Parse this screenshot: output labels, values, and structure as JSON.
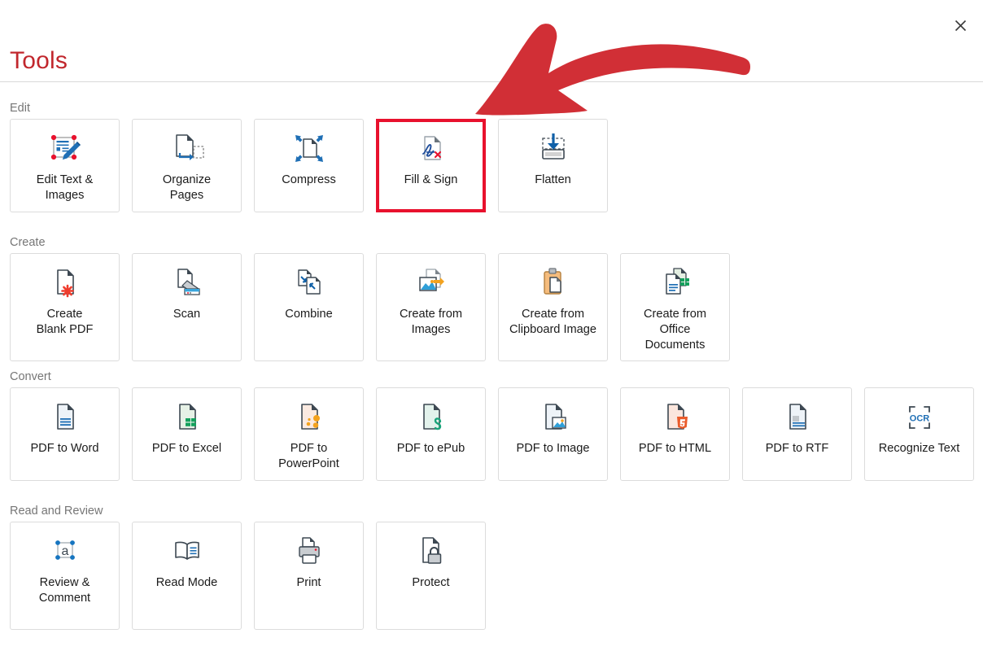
{
  "window": {
    "title": "Tools",
    "close_label": "×",
    "close_icon": "close-icon",
    "title_color": "#c1272d"
  },
  "annotation": {
    "type": "hand-drawn-arrow",
    "color": "#d12f36",
    "points_to": "Fill & Sign"
  },
  "highlight": {
    "target": "Fill & Sign",
    "color": "#e8112d"
  },
  "sections": [
    {
      "label": "Edit",
      "cards": [
        {
          "label": "Edit Text &\nImages",
          "icon": "edit-text-images-icon"
        },
        {
          "label": "Organize\nPages",
          "icon": "organize-pages-icon"
        },
        {
          "label": "Compress",
          "icon": "compress-icon"
        },
        {
          "label": "Fill & Sign",
          "icon": "fill-and-sign-icon",
          "highlighted": true
        },
        {
          "label": "Flatten",
          "icon": "flatten-icon"
        }
      ]
    },
    {
      "label": "Create",
      "cards": [
        {
          "label": "Create\nBlank PDF",
          "icon": "create-blank-pdf-icon"
        },
        {
          "label": "Scan",
          "icon": "scan-icon"
        },
        {
          "label": "Combine",
          "icon": "combine-icon"
        },
        {
          "label": "Create from\nImages",
          "icon": "create-from-images-icon"
        },
        {
          "label": "Create from\nClipboard Image",
          "icon": "create-from-clipboard-image-icon"
        },
        {
          "label": "Create from\nOffice\nDocuments",
          "icon": "create-from-office-documents-icon"
        }
      ]
    },
    {
      "label": "Convert",
      "cards": [
        {
          "label": "PDF to Word",
          "icon": "pdf-to-word-icon"
        },
        {
          "label": "PDF to Excel",
          "icon": "pdf-to-excel-icon"
        },
        {
          "label": "PDF to\nPowerPoint",
          "icon": "pdf-to-powerpoint-icon"
        },
        {
          "label": "PDF to ePub",
          "icon": "pdf-to-epub-icon"
        },
        {
          "label": "PDF to Image",
          "icon": "pdf-to-image-icon"
        },
        {
          "label": "PDF to HTML",
          "icon": "pdf-to-html-icon"
        },
        {
          "label": "PDF to RTF",
          "icon": "pdf-to-rtf-icon"
        },
        {
          "label": "Recognize Text",
          "icon": "recognize-text-ocr-icon",
          "icon_text": "OCR"
        }
      ]
    },
    {
      "label": "Read and Review",
      "cards": [
        {
          "label": "Review &\nComment",
          "icon": "review-comment-icon",
          "icon_text": "a"
        },
        {
          "label": "Read Mode",
          "icon": "read-mode-icon"
        },
        {
          "label": "Print",
          "icon": "print-icon"
        },
        {
          "label": "Protect",
          "icon": "protect-icon"
        }
      ]
    }
  ]
}
